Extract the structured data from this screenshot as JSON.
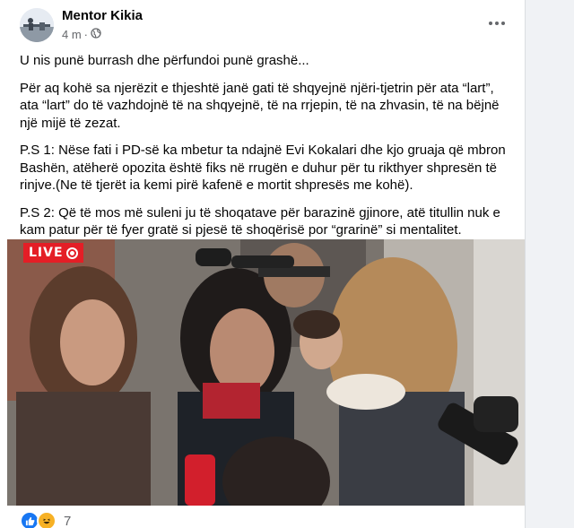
{
  "post": {
    "author": "Mentor Kikia",
    "time": "4 m",
    "separator": "·",
    "audience_icon": "globe-icon",
    "more_icon": "more-options-icon",
    "paragraphs": [
      "U nis punë burrash dhe përfundoi punë grashë...",
      "Për aq kohë sa njerëzit e thjeshtë janë gati të shqyejnë njëri-tjetrin për ata “lart”, ata “lart” do të vazhdojnë të na shqyejnë, të na rrjepin, të na zhvasin, të na bëjnë një mijë të zezat.",
      "P.S 1: Nëse fati i PD-së ka mbetur ta ndajnë Evi Kokalari dhe kjo gruaja që mbron Bashën, atëherë opozita është fiks në rrugën e duhur për tu rikthyer shpresën të rinjve.(Ne të tjerët ia kemi pirë kafenë e mortit shpresës me kohë).",
      "P.S 2: Që të mos më suleni ju të shoqatave për barazinë gjinore, atë titullin nuk e kam patur për të fyer gratë si pjesë të shoqërisë por “grarinë” si mentalitet."
    ]
  },
  "video": {
    "live_label": "LIVE"
  },
  "reactions": {
    "icons": [
      "like-icon",
      "haha-icon"
    ],
    "count": "7"
  },
  "colors": {
    "text": "#050505",
    "secondary": "#65676b",
    "live_red": "#e41e26",
    "like_blue": "#1877f2"
  }
}
